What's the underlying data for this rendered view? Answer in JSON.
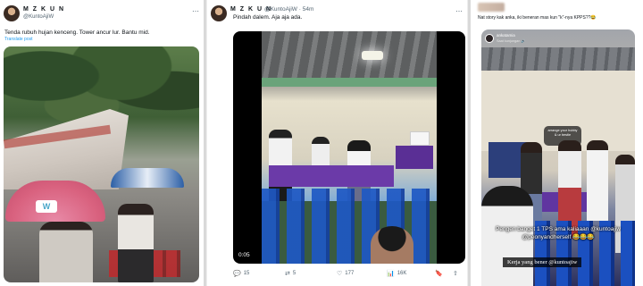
{
  "panel1": {
    "author_name": "M Z K U N",
    "handle": "@KuntoAjiW",
    "more_icon": "⋯",
    "text": "Tenda rubuh hujan kenceng. Tower ancur lur. Bantu mid.",
    "translate_label": "Translate post",
    "umbrella_logo": "W"
  },
  "panel2": {
    "author_name": "M Z K U N",
    "handle_time": "@KuntoAjiW · 54m",
    "more_icon": "⋯",
    "text": "Pindah dalem. Aja aja ada.",
    "video_duration": "0:05",
    "actions": {
      "reply_icon": "💬",
      "reply_count": "15",
      "repost_icon": "⇄",
      "repost_count": "5",
      "like_icon": "♡",
      "like_count": "177",
      "views_icon": "📊",
      "views_count": "16K",
      "bookmark_icon": "🔖",
      "share_icon": "⇧"
    }
  },
  "panel3": {
    "text": "Nat story kak anka, iki beneran mas kun \"k\"-nya KPPS??😂",
    "story_user": "ankatamia",
    "story_sub": "Saat kunjungan 🔊",
    "bubble_text": "arrange your hubby & ur bestie",
    "caption": "Pengen banget 1 TPS ama kaliaaan @kuntoajiw @peonyandherself 😂😂😂",
    "caption2": "Kerja yang bener @kuntoajiw"
  }
}
